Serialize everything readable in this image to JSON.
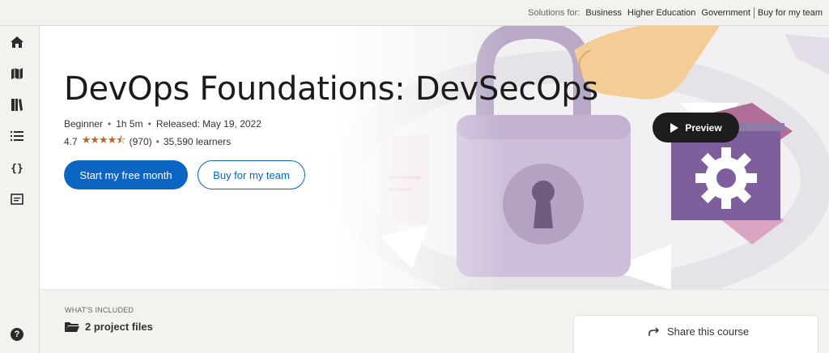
{
  "topbar": {
    "solutions_label": "Solutions for:",
    "business": "Business",
    "higher_education": "Higher Education",
    "government": "Government",
    "buy_for_team": "Buy for my team"
  },
  "sidebar": {
    "items": [
      {
        "icon": "home-icon"
      },
      {
        "icon": "map-icon"
      },
      {
        "icon": "library-icon"
      },
      {
        "icon": "list-icon"
      },
      {
        "icon": "braces-icon"
      },
      {
        "icon": "notes-icon"
      }
    ],
    "help_icon": "help-icon"
  },
  "course": {
    "title": "DevOps Foundations: DevSecOps",
    "level": "Beginner",
    "duration": "1h 5m",
    "released": "Released: May 19, 2022",
    "rating": "4.7",
    "stars": "★★★★⯪",
    "reviews": "(970)",
    "learners": "35,590 learners"
  },
  "actions": {
    "primary": "Start my free month",
    "secondary": "Buy for my team",
    "preview": "Preview"
  },
  "included": {
    "heading": "WHAT'S INCLUDED",
    "items": [
      "2 project files"
    ]
  },
  "share": {
    "label": "Share this course"
  },
  "colors": {
    "accent": "#0a66c2",
    "star": "#b5682a",
    "art_purple": "#7d5f9e",
    "art_lavender": "#cdbfd9"
  }
}
